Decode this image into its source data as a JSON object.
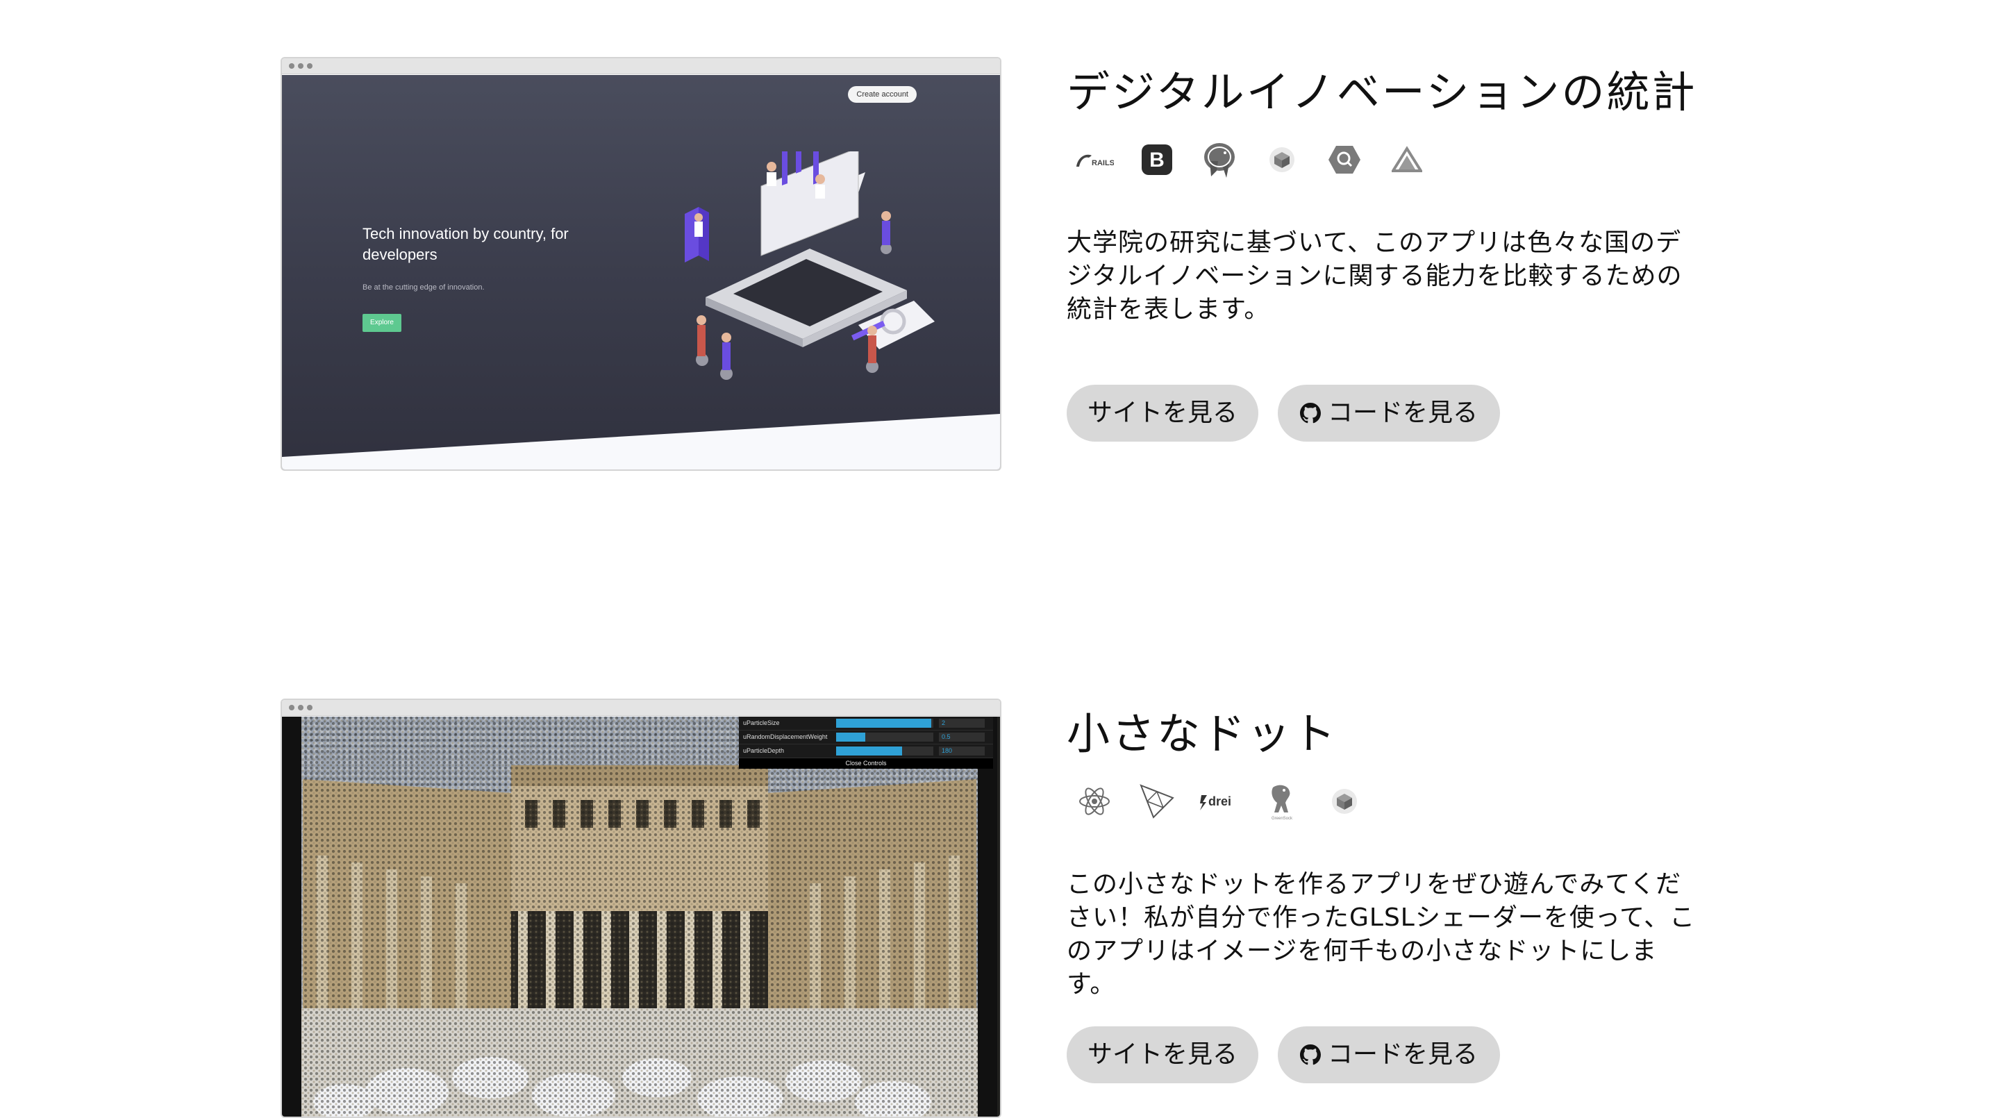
{
  "projects": [
    {
      "title": "デジタルイノベーションの統計",
      "tech_icons": [
        "rails-icon",
        "bootstrap-icon",
        "postgresql-icon",
        "threejs-cube-icon",
        "search-api-icon",
        "aws-amplify-icon"
      ],
      "tech_labels": {
        "rails": "RAILS",
        "bootstrap": "B"
      },
      "description": "大学院の研究に基づいて、このアプリは色々な国のデジタルイノベーションに関する能力を比較するための統計を表します。",
      "site_button": "サイトを見る",
      "code_button": "コードを見る",
      "screenshot": {
        "create_account": "Create account",
        "hero_title": "Tech innovation by country, for developers",
        "hero_subtitle": "Be at the cutting edge of innovation.",
        "explore": "Explore"
      }
    },
    {
      "title": "小さなドット",
      "tech_icons": [
        "react-icon",
        "threejs-icon",
        "drei-icon",
        "greensock-icon",
        "cube-icon"
      ],
      "tech_labels": {
        "drei": "drei",
        "greensock": "GreenSock"
      },
      "description": "この小さなドットを作るアプリをぜひ遊んでみてください！私が自分で作ったGLSLシェーダーを使って、このアプリはイメージを何千もの小さなドットにします。",
      "site_button": "サイトを見る",
      "code_button": "コードを見る",
      "screenshot": {
        "controls": [
          {
            "label": "uParticleSize",
            "value": "2",
            "fill": 0.98
          },
          {
            "label": "uRandomDisplacementWeight",
            "value": "0.5",
            "fill": 0.3
          },
          {
            "label": "uParticleDepth",
            "value": "180",
            "fill": 0.68
          }
        ],
        "close_controls": "Close Controls"
      }
    }
  ],
  "colors": {
    "button_bg": "#d8d8d8",
    "explore_green": "#5ec990",
    "slider_blue": "#2fa1d6",
    "hero_bg": "#3b3d4c"
  }
}
